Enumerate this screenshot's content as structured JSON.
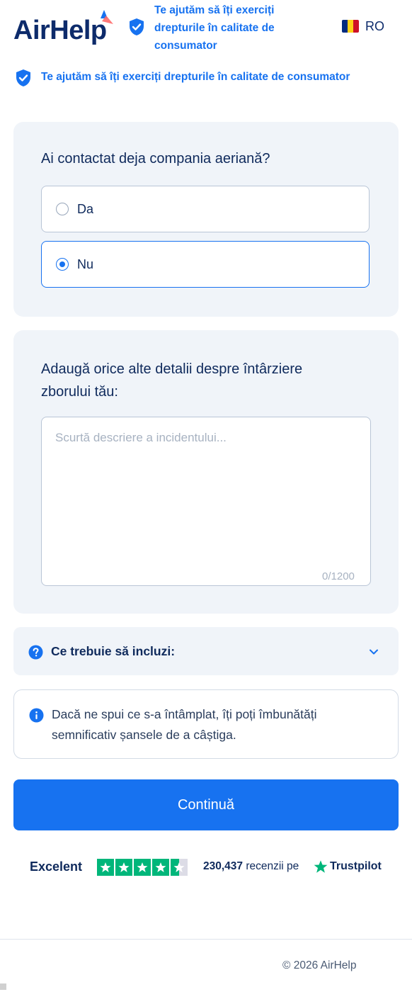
{
  "header": {
    "logo_text": "AirHelp",
    "tagline": "Te ajutăm să îți exerciți drepturile în calitate de consumator",
    "language": "RO"
  },
  "subheader": {
    "tagline": "Te ajutăm să îți exerciți drepturile în calitate de consumator"
  },
  "question": {
    "title": "Ai contactat deja compania aeriană?",
    "options": [
      {
        "label": "Da",
        "selected": false
      },
      {
        "label": "Nu",
        "selected": true
      }
    ]
  },
  "details": {
    "title": "Adaugă orice alte detalii despre întârziere zborului tău:",
    "placeholder": "Scurtă descriere a incidentului...",
    "value": "",
    "counter": "0/1200"
  },
  "accordion": {
    "label": "Ce trebuie să incluzi:"
  },
  "info": {
    "text": "Dacă ne spui ce s-a întâmplat, îți poți îmbunătăți semnificativ șansele de a câștiga."
  },
  "continue_button": {
    "label": "Continuă"
  },
  "trustpilot": {
    "rating_label": "Excelent",
    "rating_stars": 4.5,
    "review_count": "230,437",
    "reviews_text": "recenzii pe",
    "brand": "Trustpilot"
  },
  "footer": {
    "copyright": "© 2026 AirHelp"
  },
  "colors": {
    "accent": "#1772f0",
    "navy": "#0f2a5c",
    "card_bg": "#f0f4f9",
    "trustpilot_green": "#00b67a",
    "flag_blue": "#002b7f",
    "flag_yellow": "#fcd116",
    "flag_red": "#ce1126"
  },
  "icons": [
    "logo-mark-icon",
    "shield-check-icon",
    "romania-flag-icon",
    "question-icon",
    "chevron-down-icon",
    "info-icon",
    "star-icon"
  ]
}
